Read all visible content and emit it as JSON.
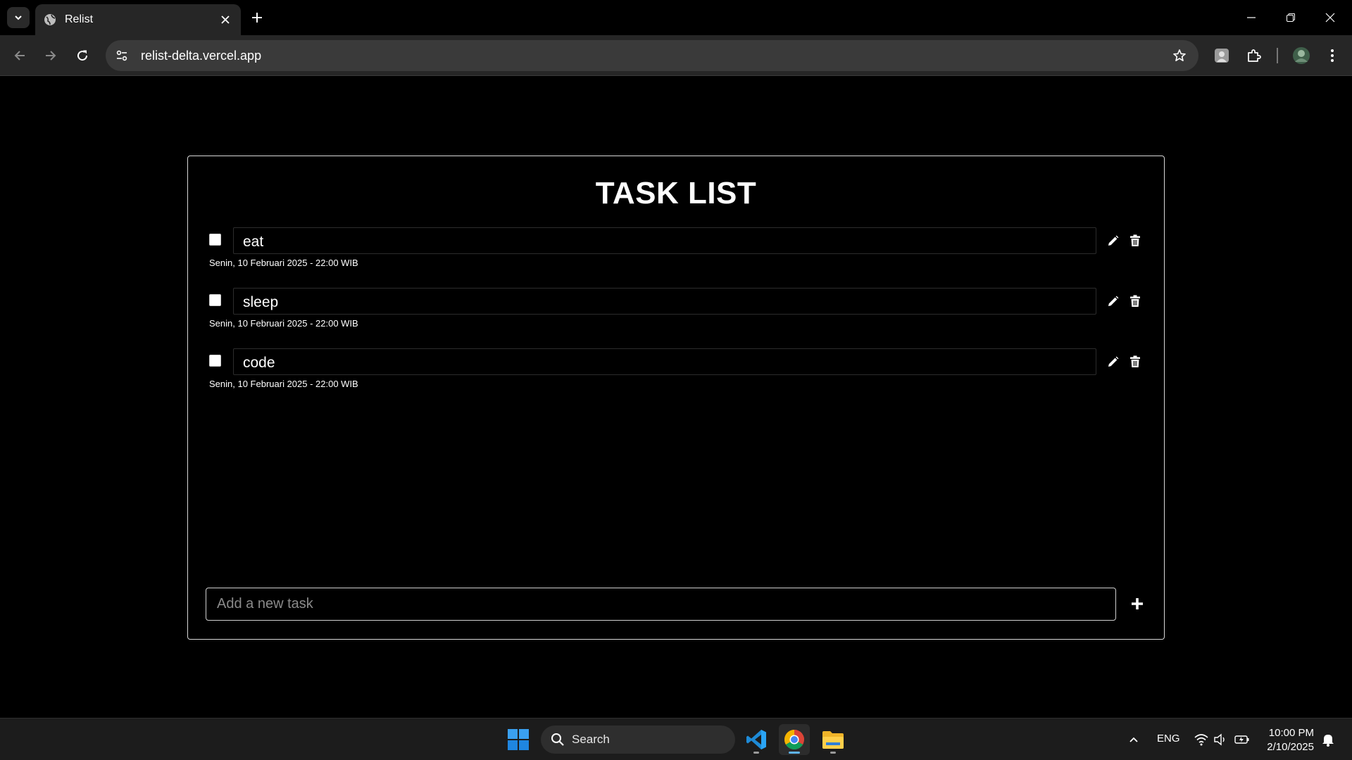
{
  "browser": {
    "tab_title": "Relist",
    "url": "relist-delta.vercel.app"
  },
  "app": {
    "title": "TASK LIST",
    "tasks": [
      {
        "text": "eat",
        "date": "Senin, 10 Februari 2025 - 22:00 WIB",
        "done": false
      },
      {
        "text": "sleep",
        "date": "Senin, 10 Februari 2025 - 22:00 WIB",
        "done": false
      },
      {
        "text": "code",
        "date": "Senin, 10 Februari 2025 - 22:00 WIB",
        "done": false
      }
    ],
    "new_task_placeholder": "Add a new task"
  },
  "taskbar": {
    "search_label": "Search",
    "language": "ENG",
    "time": "10:00 PM",
    "date": "2/10/2025"
  },
  "icons": {
    "tab_list": "chevron-down-icon",
    "favicon": "globe-icon",
    "edit": "pencil-icon",
    "delete": "trash-icon",
    "add": "plus-icon"
  },
  "colors": {
    "page_bg": "#000000",
    "chrome_bg": "#262626",
    "omnibox_bg": "#3a3a3a",
    "taskbar_bg": "#1c1c1c",
    "card_border": "#d8d8d8"
  }
}
